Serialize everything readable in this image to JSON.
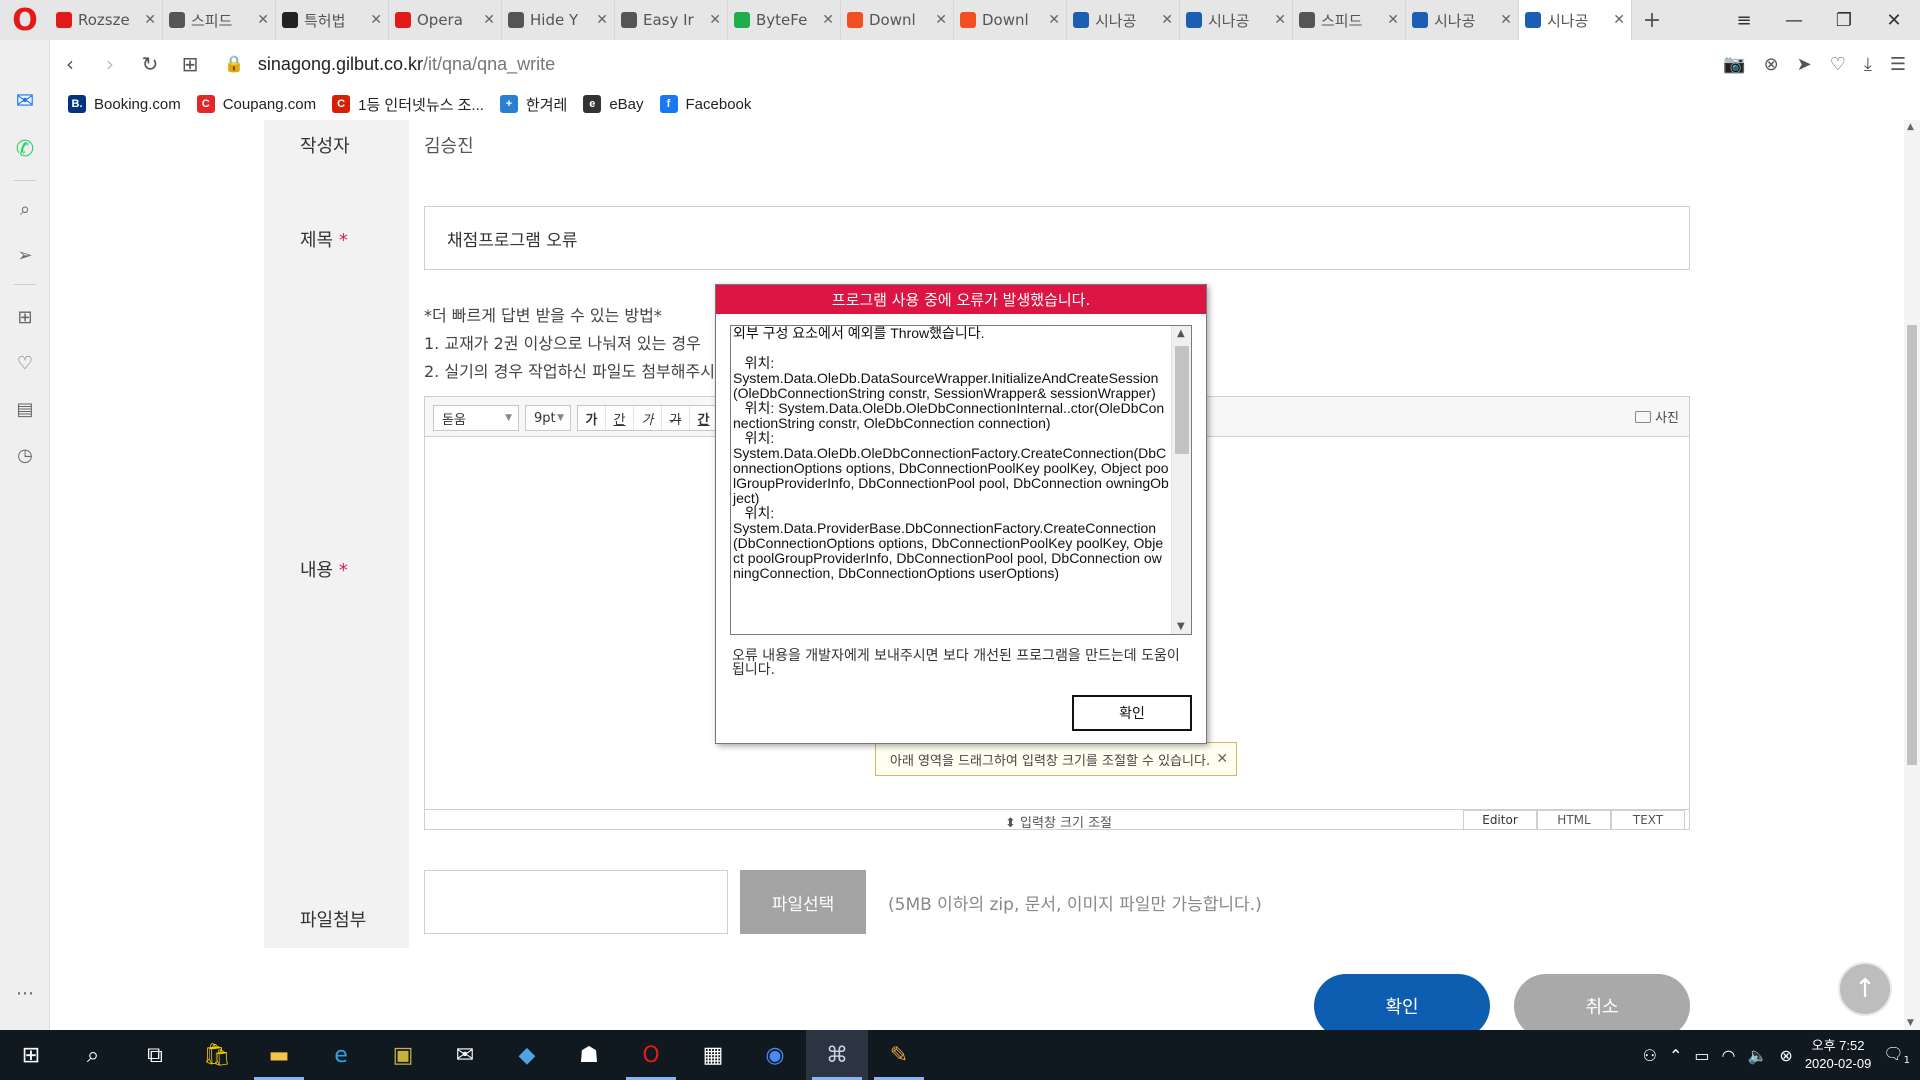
{
  "browser": {
    "tabs": [
      {
        "title": "Rozsze",
        "icon": "opera-icon",
        "color": "#e41a1a"
      },
      {
        "title": "스피드",
        "icon": "grid-icon",
        "color": "#555555"
      },
      {
        "title": "특허법",
        "icon": "document-icon",
        "color": "#222222"
      },
      {
        "title": "Opera",
        "icon": "opera-icon",
        "color": "#e41a1a"
      },
      {
        "title": "Hide Y",
        "icon": "document-icon",
        "color": "#555555"
      },
      {
        "title": "Easy Ir",
        "icon": "document-icon",
        "color": "#555555"
      },
      {
        "title": "ByteFe",
        "icon": "shield-icon",
        "color": "#1fae4b"
      },
      {
        "title": "Downl",
        "icon": "windows-icon",
        "color": "#f25022"
      },
      {
        "title": "Downl",
        "icon": "windows-icon",
        "color": "#f25022"
      },
      {
        "title": "시나공",
        "icon": "globe-icon",
        "color": "#1a5fb4"
      },
      {
        "title": "시나공",
        "icon": "globe-icon",
        "color": "#1a5fb4"
      },
      {
        "title": "스피드",
        "icon": "grid-icon",
        "color": "#555555"
      },
      {
        "title": "시나공",
        "icon": "globe-icon",
        "color": "#1a5fb4"
      },
      {
        "title": "시나공",
        "icon": "globe-icon",
        "color": "#1a5fb4"
      }
    ],
    "active_tab_index": 13,
    "url_domain": "sinagong.gilbut.co.kr",
    "url_path": "/it/qna/qna_write",
    "bookmarks": [
      {
        "label": "Booking.com",
        "icon": "booking-icon",
        "color": "#003580",
        "glyph": "B."
      },
      {
        "label": "Coupang.com",
        "icon": "coupang-icon",
        "color": "#e52528",
        "glyph": "C"
      },
      {
        "label": "1등 인터넷뉴스 조...",
        "icon": "news-icon",
        "color": "#d81e05",
        "glyph": "C"
      },
      {
        "label": "한겨레",
        "icon": "hani-icon",
        "color": "#2a7fd0",
        "glyph": "+"
      },
      {
        "label": "eBay",
        "icon": "ebay-icon",
        "color": "#333333",
        "glyph": "e"
      },
      {
        "label": "Facebook",
        "icon": "facebook-icon",
        "color": "#1877f2",
        "glyph": "f"
      }
    ]
  },
  "form": {
    "author_label": "작성자",
    "author_value": "김승진",
    "title_label": "제목",
    "required_mark": "*",
    "title_value": "채점프로그램 오류",
    "hint_heading": "*더 빠르게 답변 받을 수 있는 방법*",
    "hint_1": "1. 교재가 2권 이상으로 나눠져 있는 경우",
    "hint_2": "2. 실기의 경우 작업하신 파일도 첨부해주시",
    "content_label": "내용",
    "editor": {
      "font_select": "돋움",
      "size_select": "9pt",
      "format_buttons": [
        "가",
        "간",
        "가",
        "가",
        "간"
      ],
      "photo_label": "사진",
      "resize_label": "⬍ 입력창 크기 조절",
      "tooltip": "아래 영역을 드래그하여 입력창 크기를 조절할 수 있습니다.",
      "modes": [
        "Editor",
        "HTML",
        "TEXT"
      ]
    },
    "file_label": "파일첨부",
    "file_button": "파일선택",
    "file_note": "(5MB 이하의 zip, 문서, 이미지 파일만 가능합니다.)",
    "confirm_button": "확인",
    "cancel_button": "취소"
  },
  "dialog": {
    "title": "프로그램 사용 중에 오류가 발생했습니다.",
    "error_text": "외부 구성 요소에서 예외를 Throw했습니다.\n\n   위치:\nSystem.Data.OleDb.DataSourceWrapper.InitializeAndCreateSession(OleDbConnectionString constr, SessionWrapper& sessionWrapper)\n   위치: System.Data.OleDb.OleDbConnectionInternal..ctor(OleDbConnectionString constr, OleDbConnection connection)\n   위치:\nSystem.Data.OleDb.OleDbConnectionFactory.CreateConnection(DbConnectionOptions options, DbConnectionPoolKey poolKey, Object poolGroupProviderInfo, DbConnectionPool pool, DbConnection owningObject)\n   위치:\nSystem.Data.ProviderBase.DbConnectionFactory.CreateConnection(DbConnectionOptions options, DbConnectionPoolKey poolKey, Object poolGroupProviderInfo, DbConnectionPool pool, DbConnection owningConnection, DbConnectionOptions userOptions)",
    "note": "오류 내용을 개발자에게 보내주시면 보다 개선된 프로그램을 만드는데 도움이 됩니다.",
    "ok_button": "확인"
  },
  "taskbar": {
    "time": "오후 7:52",
    "date": "2020-02-09",
    "notification_count": "1"
  }
}
